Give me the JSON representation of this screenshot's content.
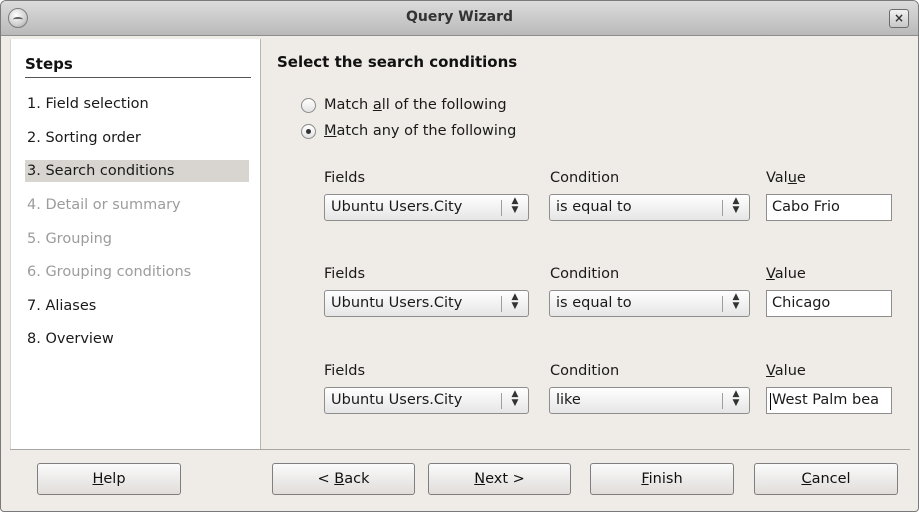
{
  "window": {
    "title": "Query Wizard",
    "close_glyph": "×"
  },
  "sidebar": {
    "heading": "Steps",
    "items": [
      {
        "label": "1. Field selection",
        "state": "enabled"
      },
      {
        "label": "2. Sorting order",
        "state": "enabled"
      },
      {
        "label": "3. Search conditions",
        "state": "active"
      },
      {
        "label": "4. Detail or summary",
        "state": "disabled"
      },
      {
        "label": "5. Grouping",
        "state": "disabled"
      },
      {
        "label": "6. Grouping conditions",
        "state": "disabled"
      },
      {
        "label": "7. Aliases",
        "state": "enabled"
      },
      {
        "label": "8. Overview",
        "state": "enabled"
      }
    ]
  },
  "main": {
    "heading": "Select the search conditions",
    "match_all": {
      "pre": "Match ",
      "key": "a",
      "post": "ll of the following",
      "checked": false
    },
    "match_any": {
      "pre": "",
      "key": "M",
      "post": "atch any of the following",
      "checked": true
    },
    "conditions": [
      {
        "fields_label": "Fields",
        "condition_label": "Condition",
        "value_label_pre": "Val",
        "value_label_key": "u",
        "value_label_post": "e",
        "field": "Ubuntu Users.City",
        "condition": "is equal to",
        "value": "Cabo Frio"
      },
      {
        "fields_label": "Fields",
        "condition_label": "Condition",
        "value_label_pre": "",
        "value_label_key": "V",
        "value_label_post": "alue",
        "field": "Ubuntu Users.City",
        "condition": "is equal to",
        "value": "Chicago"
      },
      {
        "fields_label": "Fields",
        "condition_label": "Condition",
        "value_label_pre": "",
        "value_label_key": "V",
        "value_label_post": "alue",
        "field": "Ubuntu Users.City",
        "condition": "like",
        "value": "West Palm bea"
      }
    ]
  },
  "buttons": {
    "help": {
      "pre": "",
      "key": "H",
      "post": "elp"
    },
    "back": {
      "pre": "< ",
      "key": "B",
      "post": "ack"
    },
    "next": {
      "pre": "",
      "key": "N",
      "post": "ext >"
    },
    "finish": {
      "pre": "",
      "key": "F",
      "post": "inish"
    },
    "cancel": {
      "pre": "",
      "key": "C",
      "post": "ancel"
    }
  },
  "icons": {
    "app": "app-icon",
    "close": "close-icon",
    "spinner": "up-down-arrows-icon"
  },
  "colors": {
    "window_bg": "#efebe7",
    "panel_bg": "#ffffff",
    "active_step_bg": "#d8d4d0",
    "disabled_text": "#9c9c9c"
  }
}
